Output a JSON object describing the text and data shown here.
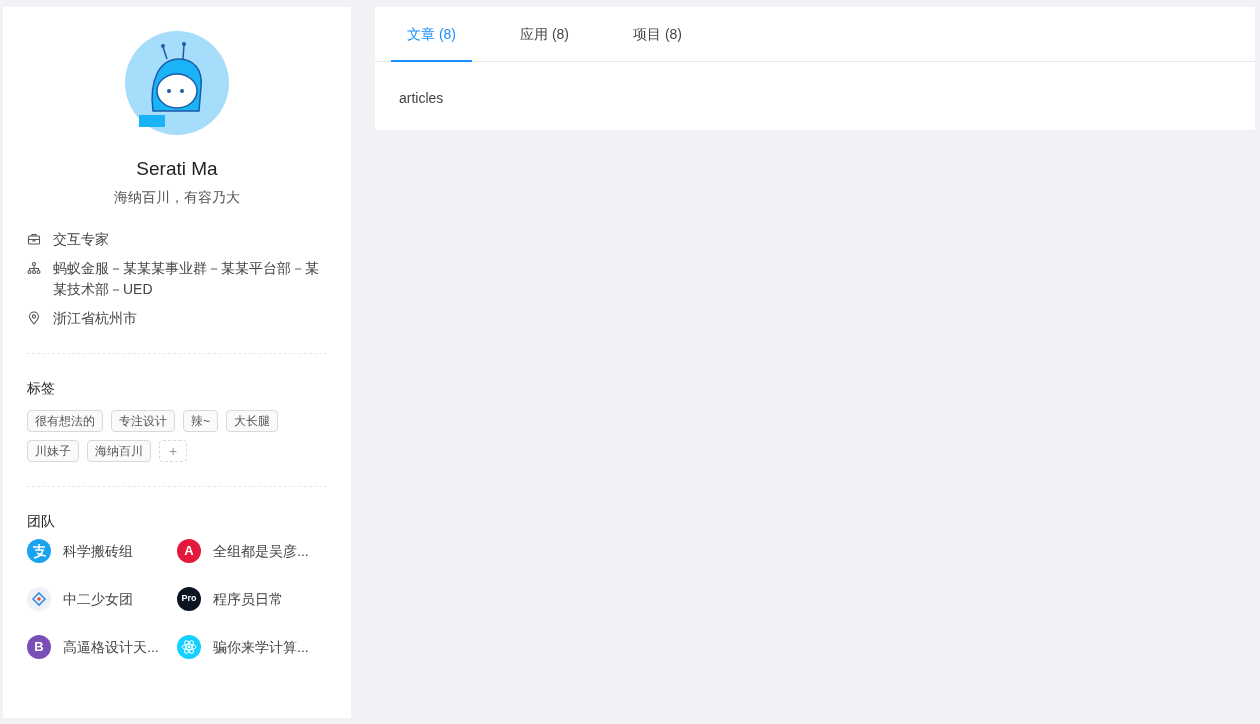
{
  "profile": {
    "name": "Serati Ma",
    "signature": "海纳百川，有容乃大",
    "details": [
      {
        "kind": "title",
        "text": "交互专家"
      },
      {
        "kind": "group",
        "text": "蚂蚁金服－某某某事业群－某某平台部－某某技术部－UED"
      },
      {
        "kind": "location",
        "text": "浙江省杭州市"
      }
    ]
  },
  "tags": {
    "heading": "标签",
    "items": [
      "很有想法的",
      "专注设计",
      "辣~",
      "大长腿",
      "川妹子",
      "海纳百川"
    ],
    "add_button": "+"
  },
  "team": {
    "heading": "团队",
    "items": [
      {
        "kind": "pay",
        "color": "#1aa3f0",
        "name": "科学搬砖组"
      },
      {
        "kind": "letter",
        "color": "#e3183b",
        "logo_text": "A",
        "name": "全组都是吴彦..."
      },
      {
        "kind": "diamond",
        "color": "#eef2f7",
        "name": "中二少女团"
      },
      {
        "kind": "letter",
        "color": "#0b1522",
        "logo_text": "Pro",
        "name": "程序员日常"
      },
      {
        "kind": "letter",
        "color": "#7a4fb5",
        "logo_text": "B",
        "name": "高逼格设计天..."
      },
      {
        "kind": "atom",
        "color": "#14d0ff",
        "name": "骗你来学计算..."
      }
    ]
  },
  "tabs": [
    {
      "label": "文章 (8)",
      "selected": true
    },
    {
      "label": "应用 (8)",
      "selected": false
    },
    {
      "label": "项目 (8)",
      "selected": false
    }
  ],
  "content": "articles"
}
